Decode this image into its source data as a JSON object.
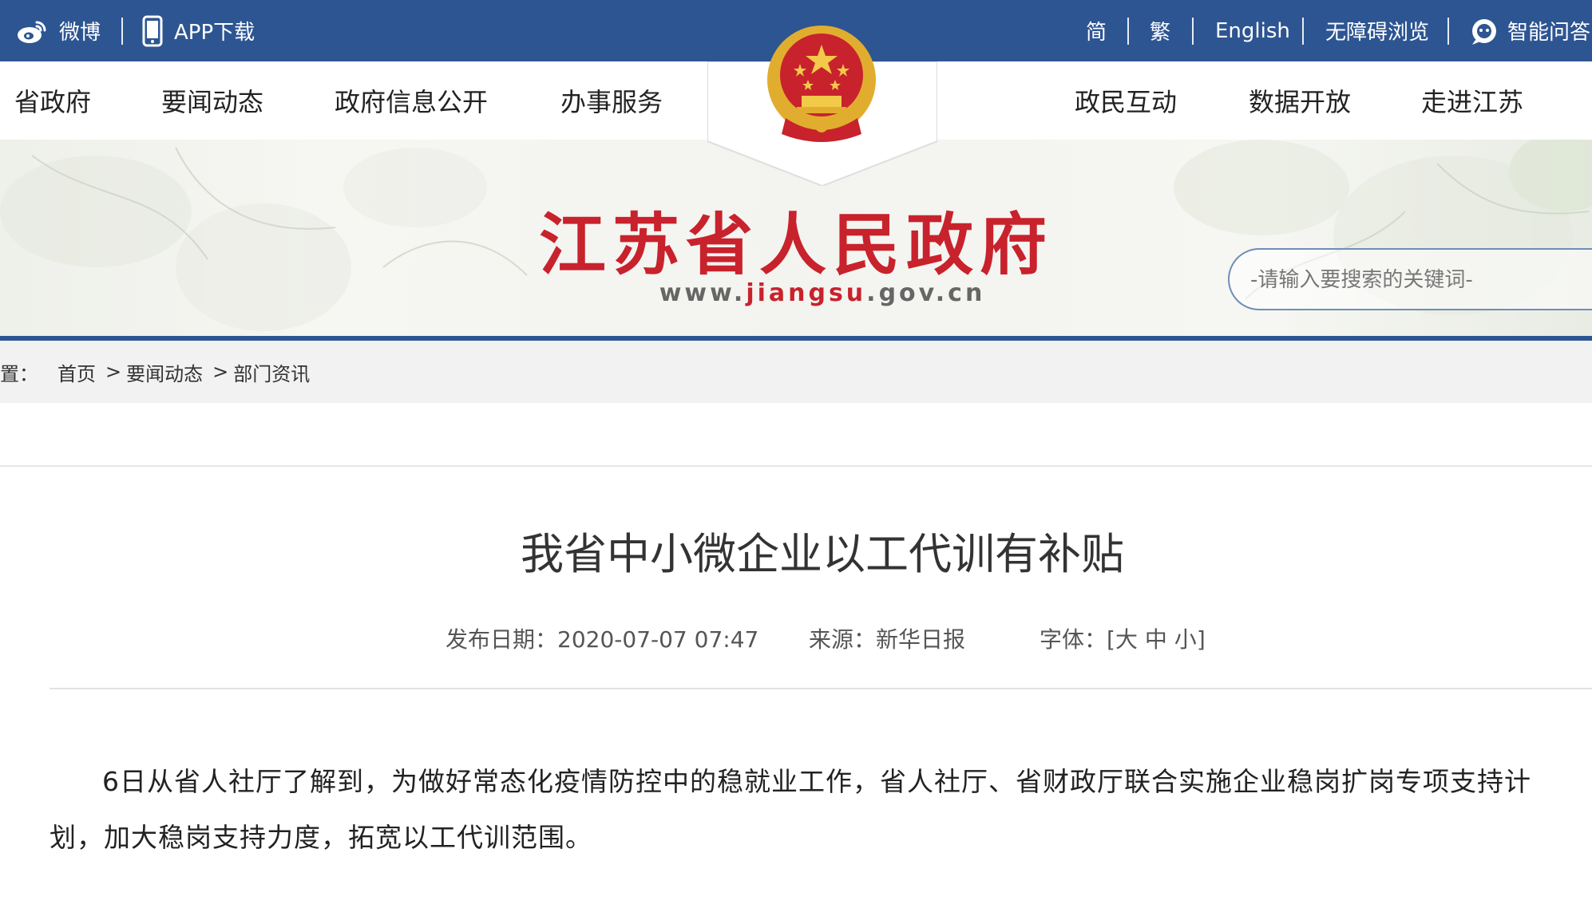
{
  "topbar": {
    "weibo_label": "微博",
    "app_label": "APP下载",
    "simplified": "简",
    "traditional": "繁",
    "english": "English",
    "accessible": "无障碍浏览",
    "qa": "智能问答"
  },
  "nav": {
    "items_left": [
      "省政府",
      "要闻动态",
      "政府信息公开",
      "办事服务"
    ],
    "items_right": [
      "政民互动",
      "数据开放",
      "走进江苏"
    ]
  },
  "banner": {
    "title": "江苏省人民政府",
    "url_prefix": "www.",
    "url_highlight": "jiangsu",
    "url_suffix": ".gov.cn",
    "search_placeholder": "-请输入要搜索的关键词-"
  },
  "breadcrumb": {
    "prefix": "置：",
    "items": [
      "首页",
      "要闻动态",
      "部门资讯"
    ],
    "separator": ">"
  },
  "article": {
    "title": "我省中小微企业以工代训有补贴",
    "date_label": "发布日期：",
    "date": "2020-07-07 07:47",
    "source_label": "来源：",
    "source": "新华日报",
    "font_label": "字体：",
    "font_open": "[",
    "font_large": "大",
    "font_medium": "中",
    "font_small": "小",
    "font_close": "]",
    "paragraph": "6日从省人社厅了解到，为做好常态化疫情防控中的稳就业工作，省人社厅、省财政厅联合实施企业稳岗扩岗专项支持计划，加大稳岗支持力度，拓宽以工代训范围。"
  },
  "colors": {
    "topbar": "#2d5592",
    "title_red": "#c8222d",
    "emblem_gold": "#e1ad2f"
  }
}
